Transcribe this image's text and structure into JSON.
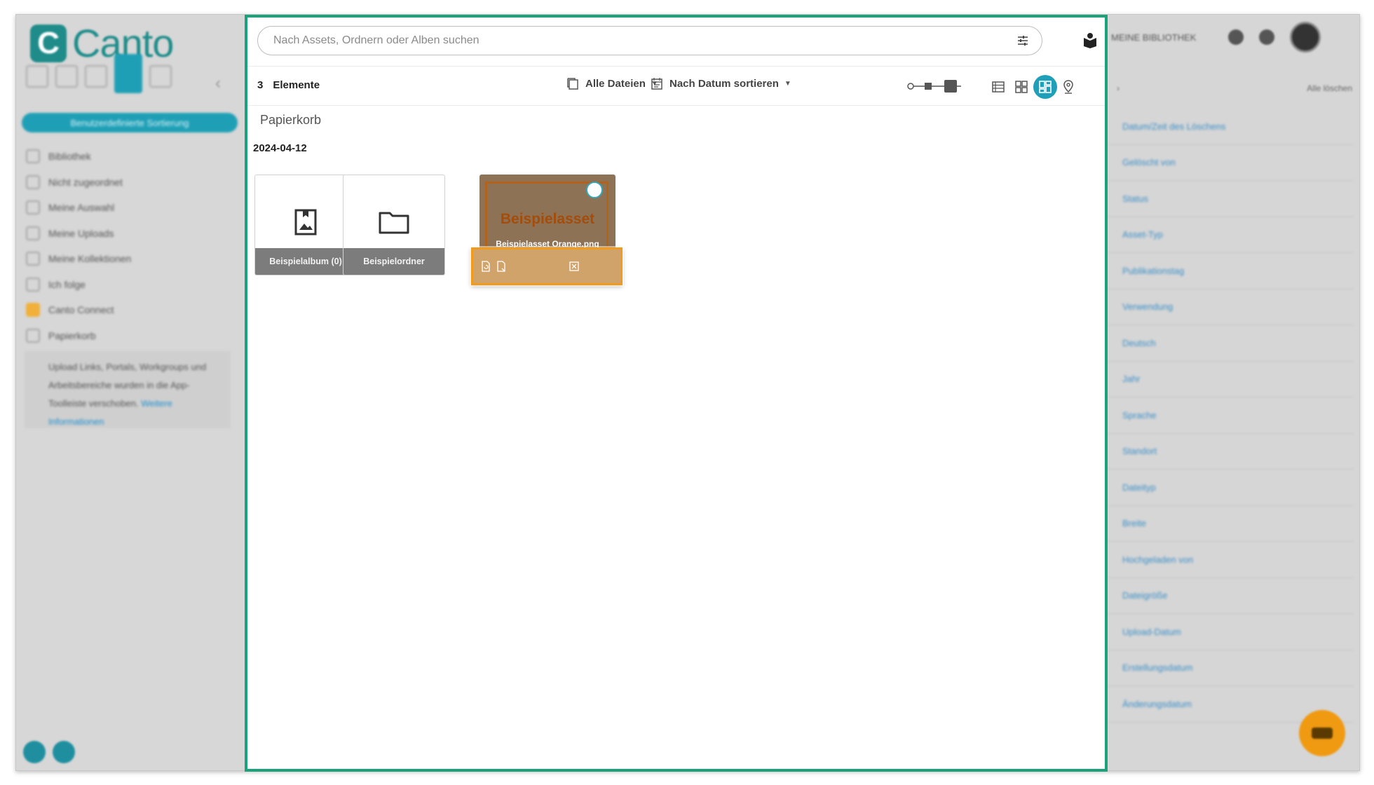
{
  "app": {
    "logo_text": "Canto"
  },
  "sidebar": {
    "primary_button": "Benutzerdefinierte Sortierung",
    "items": [
      {
        "label": "Bibliothek",
        "icon": "library-icon"
      },
      {
        "label": "Nicht zugeordnet",
        "icon": "grid-icon"
      },
      {
        "label": "Meine Auswahl",
        "icon": "selection-icon"
      },
      {
        "label": "Meine Uploads",
        "icon": "upload-icon"
      },
      {
        "label": "Meine Kollektionen",
        "icon": "heart-icon"
      },
      {
        "label": "Ich folge",
        "icon": "follow-icon"
      },
      {
        "label": "Canto Connect",
        "icon": "connect-icon"
      },
      {
        "label": "Papierkorb",
        "icon": "trash-icon"
      }
    ],
    "info": {
      "text": "Upload Links, Portals, Workgroups und Arbeitsbereiche wurden in die App-Toolleiste verschoben.",
      "link": "Weitere Informationen"
    }
  },
  "search": {
    "placeholder": "Nach Assets, Ordnern oder Alben suchen"
  },
  "toolbar": {
    "count": "3",
    "count_label": "Elemente",
    "file_filter": "Alle Dateien",
    "sort": "Nach Datum sortieren"
  },
  "breadcrumb": "Papierkorb",
  "group_date": "2024-04-12",
  "items": [
    {
      "type": "album",
      "label": "Beispielalbum (0)",
      "icon": "album-icon"
    },
    {
      "type": "folder",
      "label": "Beispielordner",
      "icon": "folder-icon"
    },
    {
      "type": "asset",
      "thumb_title": "Beispielasset",
      "label": "Beispielasset Orange.png",
      "accent": "#b2621a"
    }
  ],
  "right_panel": {
    "library_selector": "MEINE BIBLIOTHEK",
    "clear_all": "Alle löschen",
    "filters": [
      "Datum/Zeit des Löschens",
      "Gelöscht von",
      "Status",
      "Asset-Typ",
      "Publikationstag",
      "Verwendung",
      "Deutsch",
      "Jahr",
      "Sprache",
      "Standort",
      "Dateityp",
      "Breite",
      "Hochgeladen von",
      "Dateigröße",
      "Upload-Datum",
      "Erstellungsdatum",
      "Änderungsdatum"
    ]
  },
  "colors": {
    "accent": "#1fa0b8",
    "highlight_border": "#1aa37a",
    "focus_border": "#f29a19"
  }
}
